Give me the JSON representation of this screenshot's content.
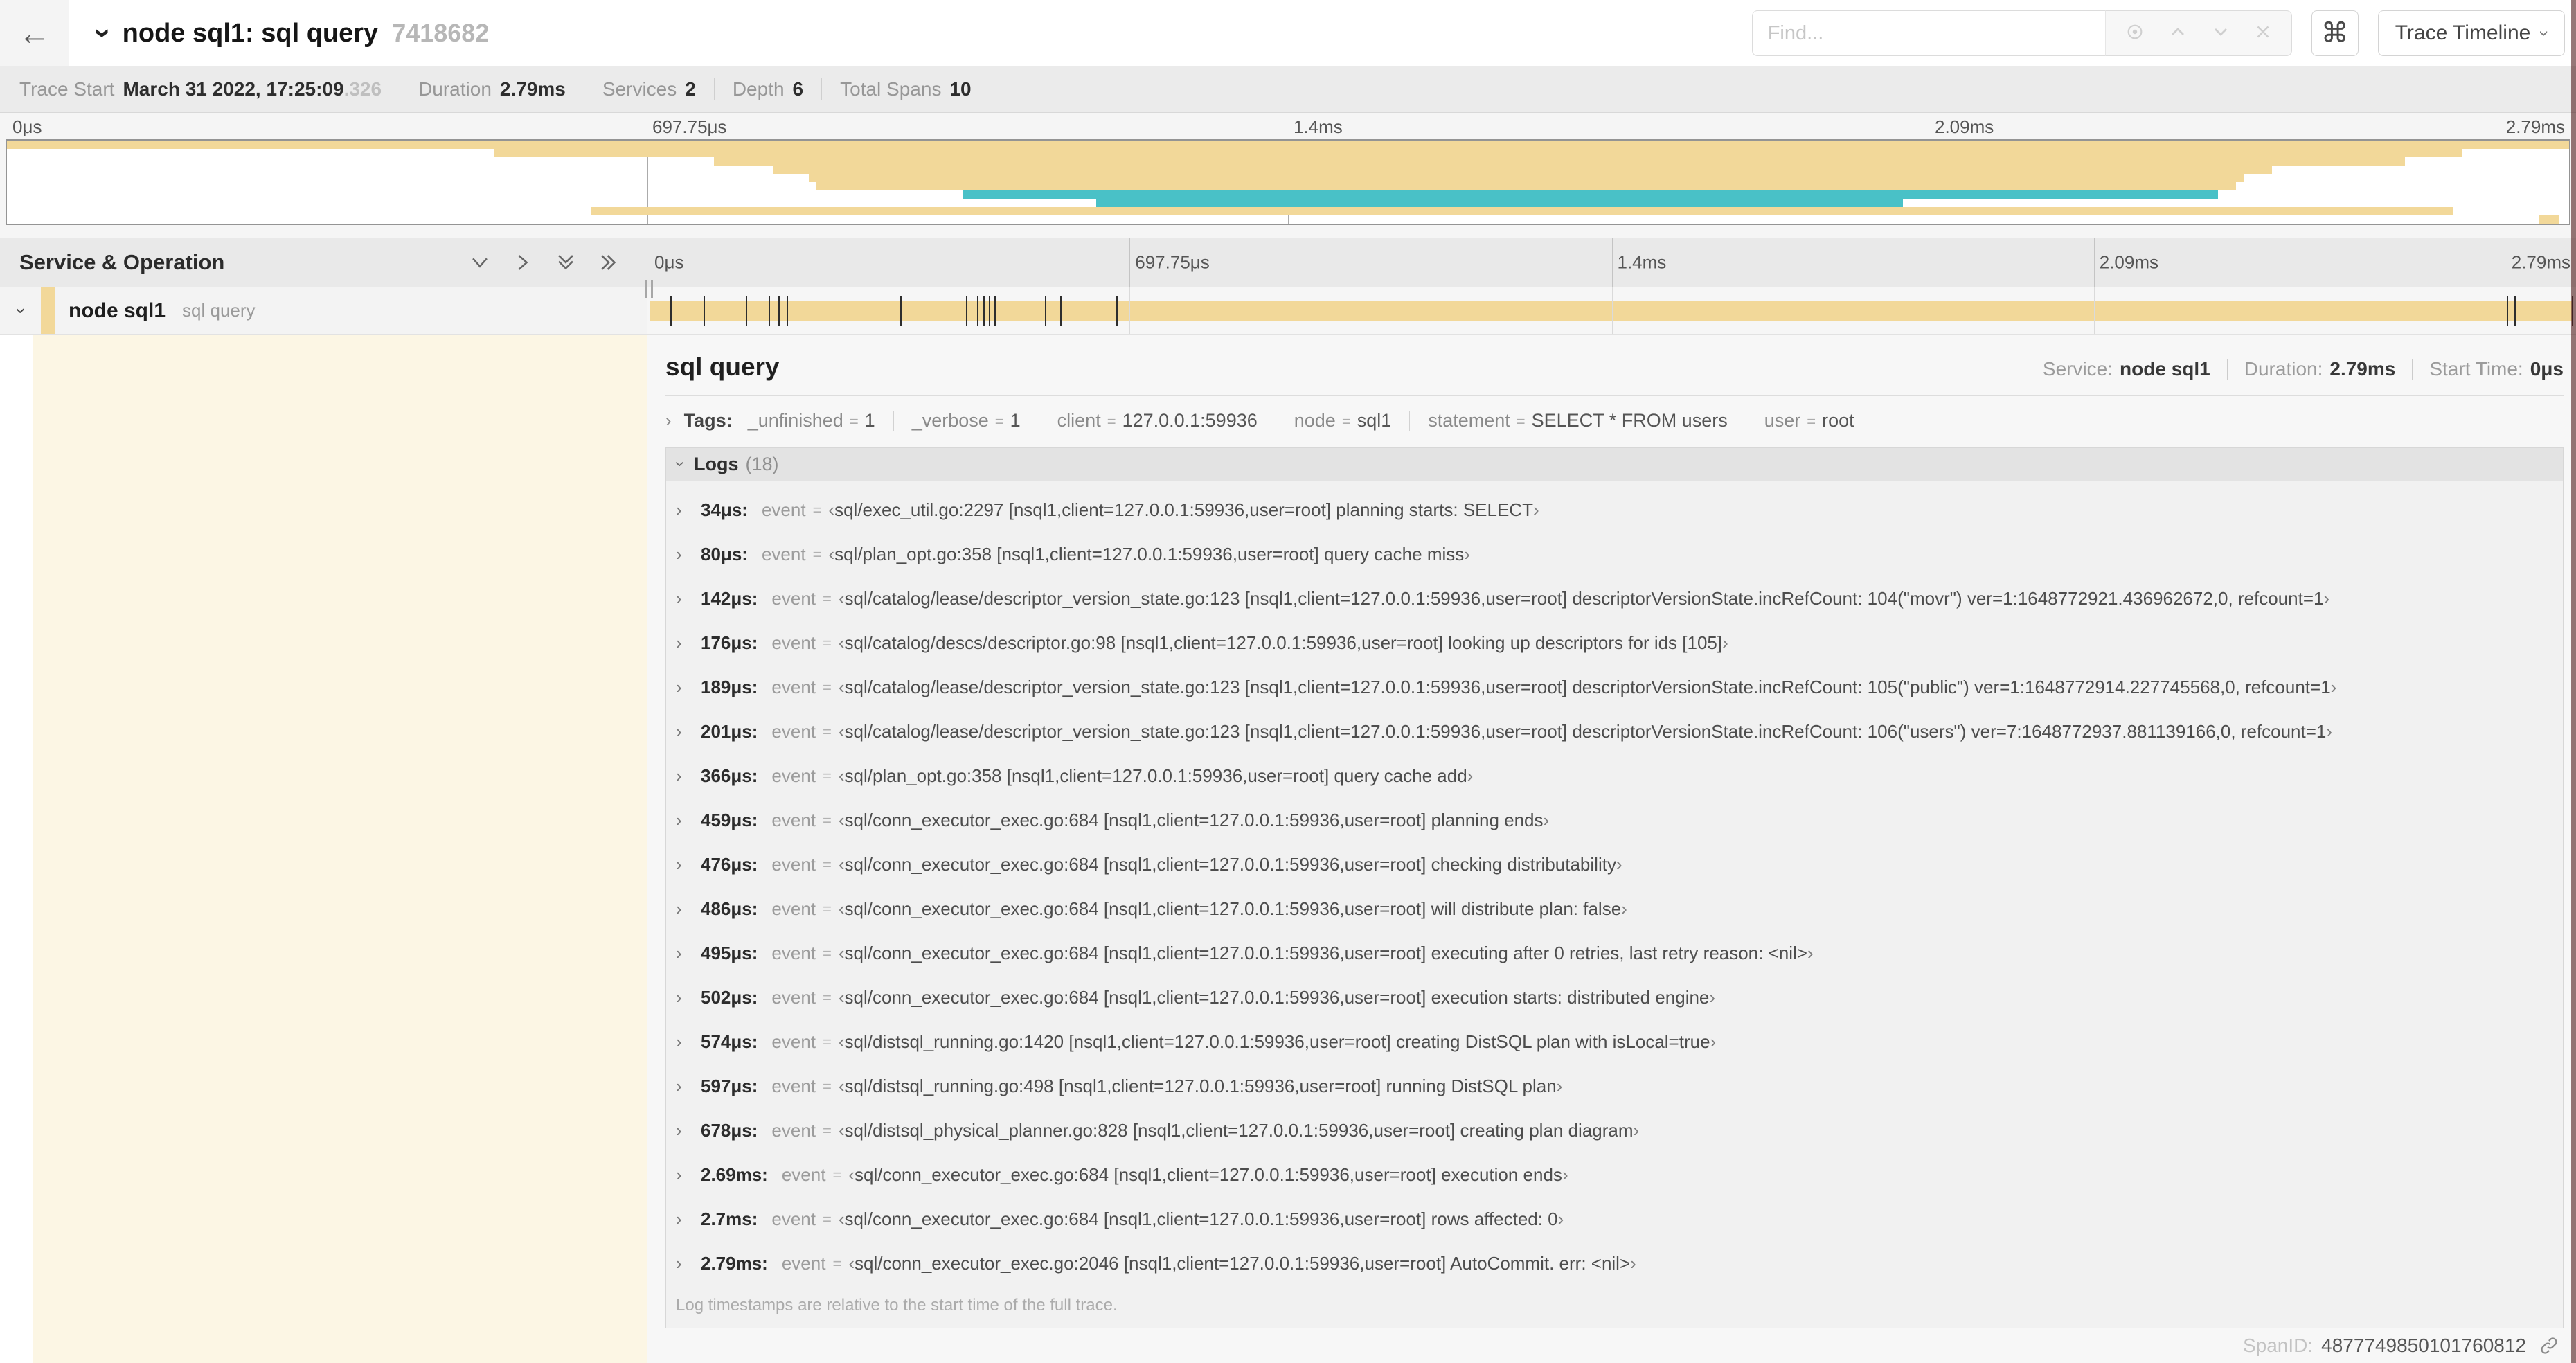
{
  "header": {
    "title": "node sql1: sql query",
    "trace_id": "7418682",
    "find_placeholder": "Find...",
    "view_button_label": "Trace Timeline"
  },
  "glyphs": {
    "back_arrow": "←",
    "chevron_right": "›",
    "keyboard_cmd": "⌘",
    "open_quote": "‹",
    "close_quote": "›",
    "equals": "="
  },
  "meta": {
    "items": [
      {
        "label": "Trace Start",
        "value": "March 31 2022, 17:25:09",
        "suffix": ".326"
      },
      {
        "label": "Duration",
        "value": "2.79ms"
      },
      {
        "label": "Services",
        "value": "2"
      },
      {
        "label": "Depth",
        "value": "6"
      },
      {
        "label": "Total Spans",
        "value": "10"
      }
    ]
  },
  "timeline": {
    "axis": [
      {
        "label": "0μs",
        "pos": 0
      },
      {
        "label": "697.75μs",
        "pos": 25
      },
      {
        "label": "1.4ms",
        "pos": 50
      },
      {
        "label": "2.09ms",
        "pos": 75
      },
      {
        "label": "2.79ms",
        "pos": 100
      }
    ],
    "log_markers": [
      1.2,
      2.9,
      5.1,
      6.3,
      6.8,
      7.2,
      13.1,
      16.5,
      17.1,
      17.4,
      17.7,
      18.0,
      20.6,
      21.4,
      24.3,
      96.4,
      96.8,
      99.8
    ]
  },
  "minimap": {
    "colors": {
      "tan": "#F2D899",
      "teal": "#49C1C7"
    },
    "spans": [
      {
        "start": 0.0,
        "end": 1.0,
        "color": "tan"
      },
      {
        "start": 0.19,
        "end": 0.958,
        "color": "tan"
      },
      {
        "start": 0.276,
        "end": 0.936,
        "color": "tan"
      },
      {
        "start": 0.299,
        "end": 0.884,
        "color": "tan"
      },
      {
        "start": 0.313,
        "end": 0.873,
        "color": "tan"
      },
      {
        "start": 0.316,
        "end": 0.87,
        "color": "tan"
      },
      {
        "start": 0.373,
        "end": 0.863,
        "color": "teal"
      },
      {
        "start": 0.425,
        "end": 0.74,
        "color": "teal"
      },
      {
        "start": 0.228,
        "end": 0.955,
        "color": "tan"
      },
      {
        "start": 0.988,
        "end": 0.996,
        "color": "tan"
      }
    ]
  },
  "sidebar": {
    "title": "Service & Operation",
    "row": {
      "service": "node sql1",
      "operation": "sql query"
    }
  },
  "span_detail": {
    "title": "sql query",
    "service_label": "Service:",
    "service": "node sql1",
    "duration_label": "Duration:",
    "duration": "2.79ms",
    "start_label": "Start Time:",
    "start": "0μs"
  },
  "tags": {
    "label": "Tags:",
    "items": [
      {
        "key": "_unfinished",
        "value": "1"
      },
      {
        "key": "_verbose",
        "value": "1"
      },
      {
        "key": "client",
        "value": "127.0.0.1:59936"
      },
      {
        "key": "node",
        "value": "sql1"
      },
      {
        "key": "statement",
        "value": "SELECT * FROM users"
      },
      {
        "key": "user",
        "value": "root"
      }
    ]
  },
  "logs": {
    "title": "Logs",
    "count": "(18)",
    "event_key": "event",
    "entries": [
      {
        "time": "34μs",
        "value": "sql/exec_util.go:2297 [nsql1,client=127.0.0.1:59936,user=root] planning starts: SELECT"
      },
      {
        "time": "80μs",
        "value": "sql/plan_opt.go:358 [nsql1,client=127.0.0.1:59936,user=root] query cache miss"
      },
      {
        "time": "142μs",
        "value": "sql/catalog/lease/descriptor_version_state.go:123 [nsql1,client=127.0.0.1:59936,user=root] descriptorVersionState.incRefCount: 104(\"movr\") ver=1:1648772921.436962672,0, refcount=1"
      },
      {
        "time": "176μs",
        "value": "sql/catalog/descs/descriptor.go:98 [nsql1,client=127.0.0.1:59936,user=root] looking up descriptors for ids [105]"
      },
      {
        "time": "189μs",
        "value": "sql/catalog/lease/descriptor_version_state.go:123 [nsql1,client=127.0.0.1:59936,user=root] descriptorVersionState.incRefCount: 105(\"public\") ver=1:1648772914.227745568,0, refcount=1"
      },
      {
        "time": "201μs",
        "value": "sql/catalog/lease/descriptor_version_state.go:123 [nsql1,client=127.0.0.1:59936,user=root] descriptorVersionState.incRefCount: 106(\"users\") ver=7:1648772937.881139166,0, refcount=1"
      },
      {
        "time": "366μs",
        "value": "sql/plan_opt.go:358 [nsql1,client=127.0.0.1:59936,user=root] query cache add"
      },
      {
        "time": "459μs",
        "value": "sql/conn_executor_exec.go:684 [nsql1,client=127.0.0.1:59936,user=root] planning ends"
      },
      {
        "time": "476μs",
        "value": "sql/conn_executor_exec.go:684 [nsql1,client=127.0.0.1:59936,user=root] checking distributability"
      },
      {
        "time": "486μs",
        "value": "sql/conn_executor_exec.go:684 [nsql1,client=127.0.0.1:59936,user=root] will distribute plan: false"
      },
      {
        "time": "495μs",
        "value": "sql/conn_executor_exec.go:684 [nsql1,client=127.0.0.1:59936,user=root] executing after 0 retries, last retry reason: <nil>"
      },
      {
        "time": "502μs",
        "value": "sql/conn_executor_exec.go:684 [nsql1,client=127.0.0.1:59936,user=root] execution starts: distributed engine"
      },
      {
        "time": "574μs",
        "value": "sql/distsql_running.go:1420 [nsql1,client=127.0.0.1:59936,user=root] creating DistSQL plan with isLocal=true"
      },
      {
        "time": "597μs",
        "value": "sql/distsql_running.go:498 [nsql1,client=127.0.0.1:59936,user=root] running DistSQL plan"
      },
      {
        "time": "678μs",
        "value": "sql/distsql_physical_planner.go:828 [nsql1,client=127.0.0.1:59936,user=root] creating plan diagram"
      },
      {
        "time": "2.69ms",
        "value": "sql/conn_executor_exec.go:684 [nsql1,client=127.0.0.1:59936,user=root] execution ends"
      },
      {
        "time": "2.7ms",
        "value": "sql/conn_executor_exec.go:684 [nsql1,client=127.0.0.1:59936,user=root] rows affected: 0"
      },
      {
        "time": "2.79ms",
        "value": "sql/conn_executor_exec.go:2046 [nsql1,client=127.0.0.1:59936,user=root] AutoCommit. err: <nil>"
      }
    ],
    "footnote": "Log timestamps are relative to the start time of the full trace."
  },
  "footer": {
    "span_id_label": "SpanID:",
    "span_id": "4877749850101760812"
  }
}
